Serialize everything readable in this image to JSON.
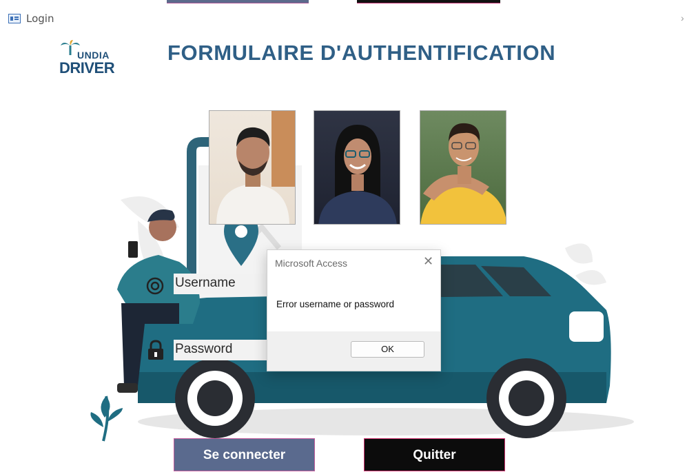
{
  "window": {
    "title": "Login",
    "close_glyph": "›"
  },
  "logo": {
    "line1": "UNDIA",
    "line2": "DRIVER",
    "icon": "palm-leaf-logo"
  },
  "heading": "FORMULAIRE D'AUTHENTIFICATION",
  "photos": [
    {
      "name": "team-photo-1"
    },
    {
      "name": "team-photo-2"
    },
    {
      "name": "team-photo-3"
    }
  ],
  "form": {
    "username_label": "Username",
    "password_label": "Password",
    "username_icon": "user-circle-icon",
    "password_icon": "padlock-icon"
  },
  "dialog": {
    "title": "Microsoft Access",
    "message": "Error username or password",
    "ok_label": "OK",
    "close_glyph": "✕"
  },
  "buttons": {
    "connect_label": "Se connecter",
    "quit_label": "Quitter"
  },
  "colors": {
    "title_blue": "#2f5f86",
    "car_teal": "#1f6d82",
    "connect_bg": "#5a6a8e",
    "quit_bg": "#0c0c0c"
  }
}
